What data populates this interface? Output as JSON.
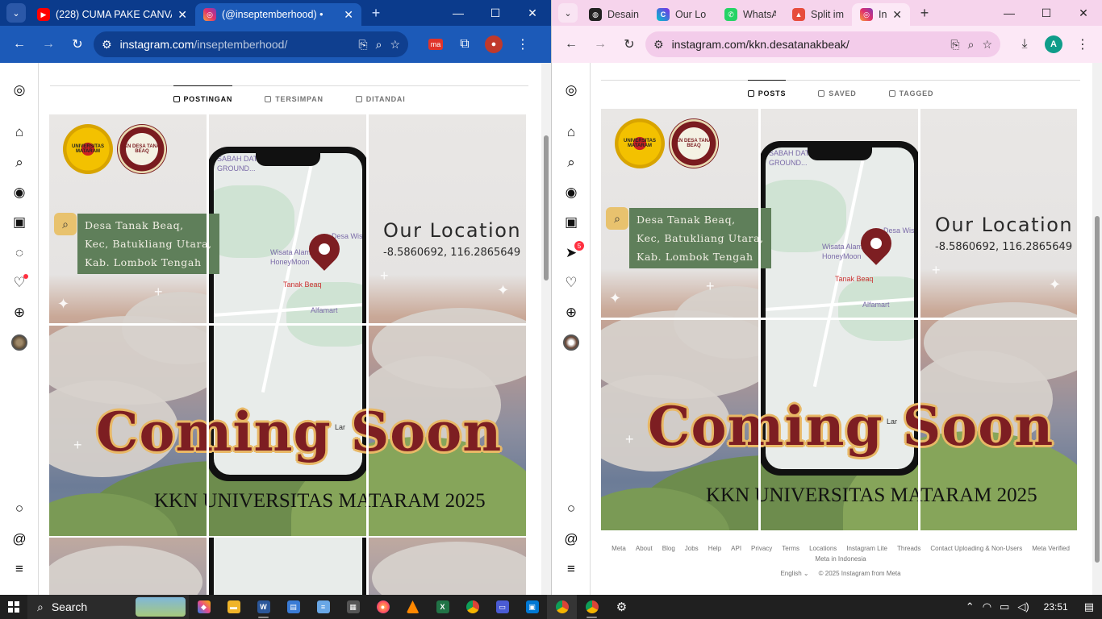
{
  "left_window": {
    "tabs": [
      {
        "title": "(228) CUMA PAKE CANVA",
        "icon": "youtube-icon",
        "active": false
      },
      {
        "title": "(@inseptemberhood) •",
        "icon": "instagram-icon",
        "active": true
      }
    ],
    "url": {
      "host": "instagram.com",
      "path": "/inseptemberhood/"
    },
    "profile_tabs": [
      {
        "label": "POSTINGAN",
        "active": true
      },
      {
        "label": "TERSIMPAN",
        "active": false
      },
      {
        "label": "DITANDAI",
        "active": false
      }
    ]
  },
  "right_window": {
    "tabs": [
      {
        "title": "Desain",
        "icon": "canva-icon",
        "active": false
      },
      {
        "title": "Our Lo",
        "icon": "canva-c-icon",
        "active": false
      },
      {
        "title": "WhatsA",
        "icon": "whatsapp-icon",
        "active": false
      },
      {
        "title": "Split im",
        "icon": "split-icon",
        "active": false
      },
      {
        "title": "Ins",
        "icon": "instagram-icon",
        "active": true
      }
    ],
    "url": {
      "host": "instagram.com",
      "path": "/kkn.desatanakbeak/"
    },
    "profile_avatar_letter": "A",
    "profile_tabs": [
      {
        "label": "POSTS",
        "active": true
      },
      {
        "label": "SAVED",
        "active": false
      },
      {
        "label": "TAGGED",
        "active": false
      }
    ],
    "notification_badge": "5",
    "footer": {
      "links": [
        "Meta",
        "About",
        "Blog",
        "Jobs",
        "Help",
        "API",
        "Privacy",
        "Terms",
        "Locations",
        "Instagram Lite",
        "Threads",
        "Contact Uploading & Non-Users",
        "Meta Verified",
        "Meta in Indonesia"
      ],
      "language": "English",
      "copyright": "© 2025 Instagram from Meta"
    }
  },
  "poster": {
    "address_lines": [
      "Desa Tanak Beaq,",
      "Kec, Batukliang Utara,",
      "Kab. Lombok Tengah"
    ],
    "location_title": "Our Location",
    "coordinates": "-8.5860692, 116.2865649",
    "headline": "Coming Soon",
    "subtitle": "KKN UNIVERSITAS MATARAM 2025",
    "map_labels": {
      "top": "SABAH DATU",
      "ground": "GROUND...",
      "wisata": "Wisata Alam",
      "honeymoon": "HoneyMoon",
      "place": "Tanak Beaq",
      "wisata2": "Desa Wis",
      "shop": "Alfamart",
      "lar": "Lar"
    },
    "logo_unram": "UNIVERSITAS MATARAM",
    "logo_kkn": "KKN DESA TANAK BEAQ"
  },
  "taskbar": {
    "search_label": "Search",
    "time": "23:51"
  },
  "colors": {
    "left_chrome": "#1c5ab8",
    "right_chrome": "#fce8f6",
    "headline": "#7d1e22",
    "headline_outline": "#e8b866",
    "address_box": "#5f7f5a"
  }
}
